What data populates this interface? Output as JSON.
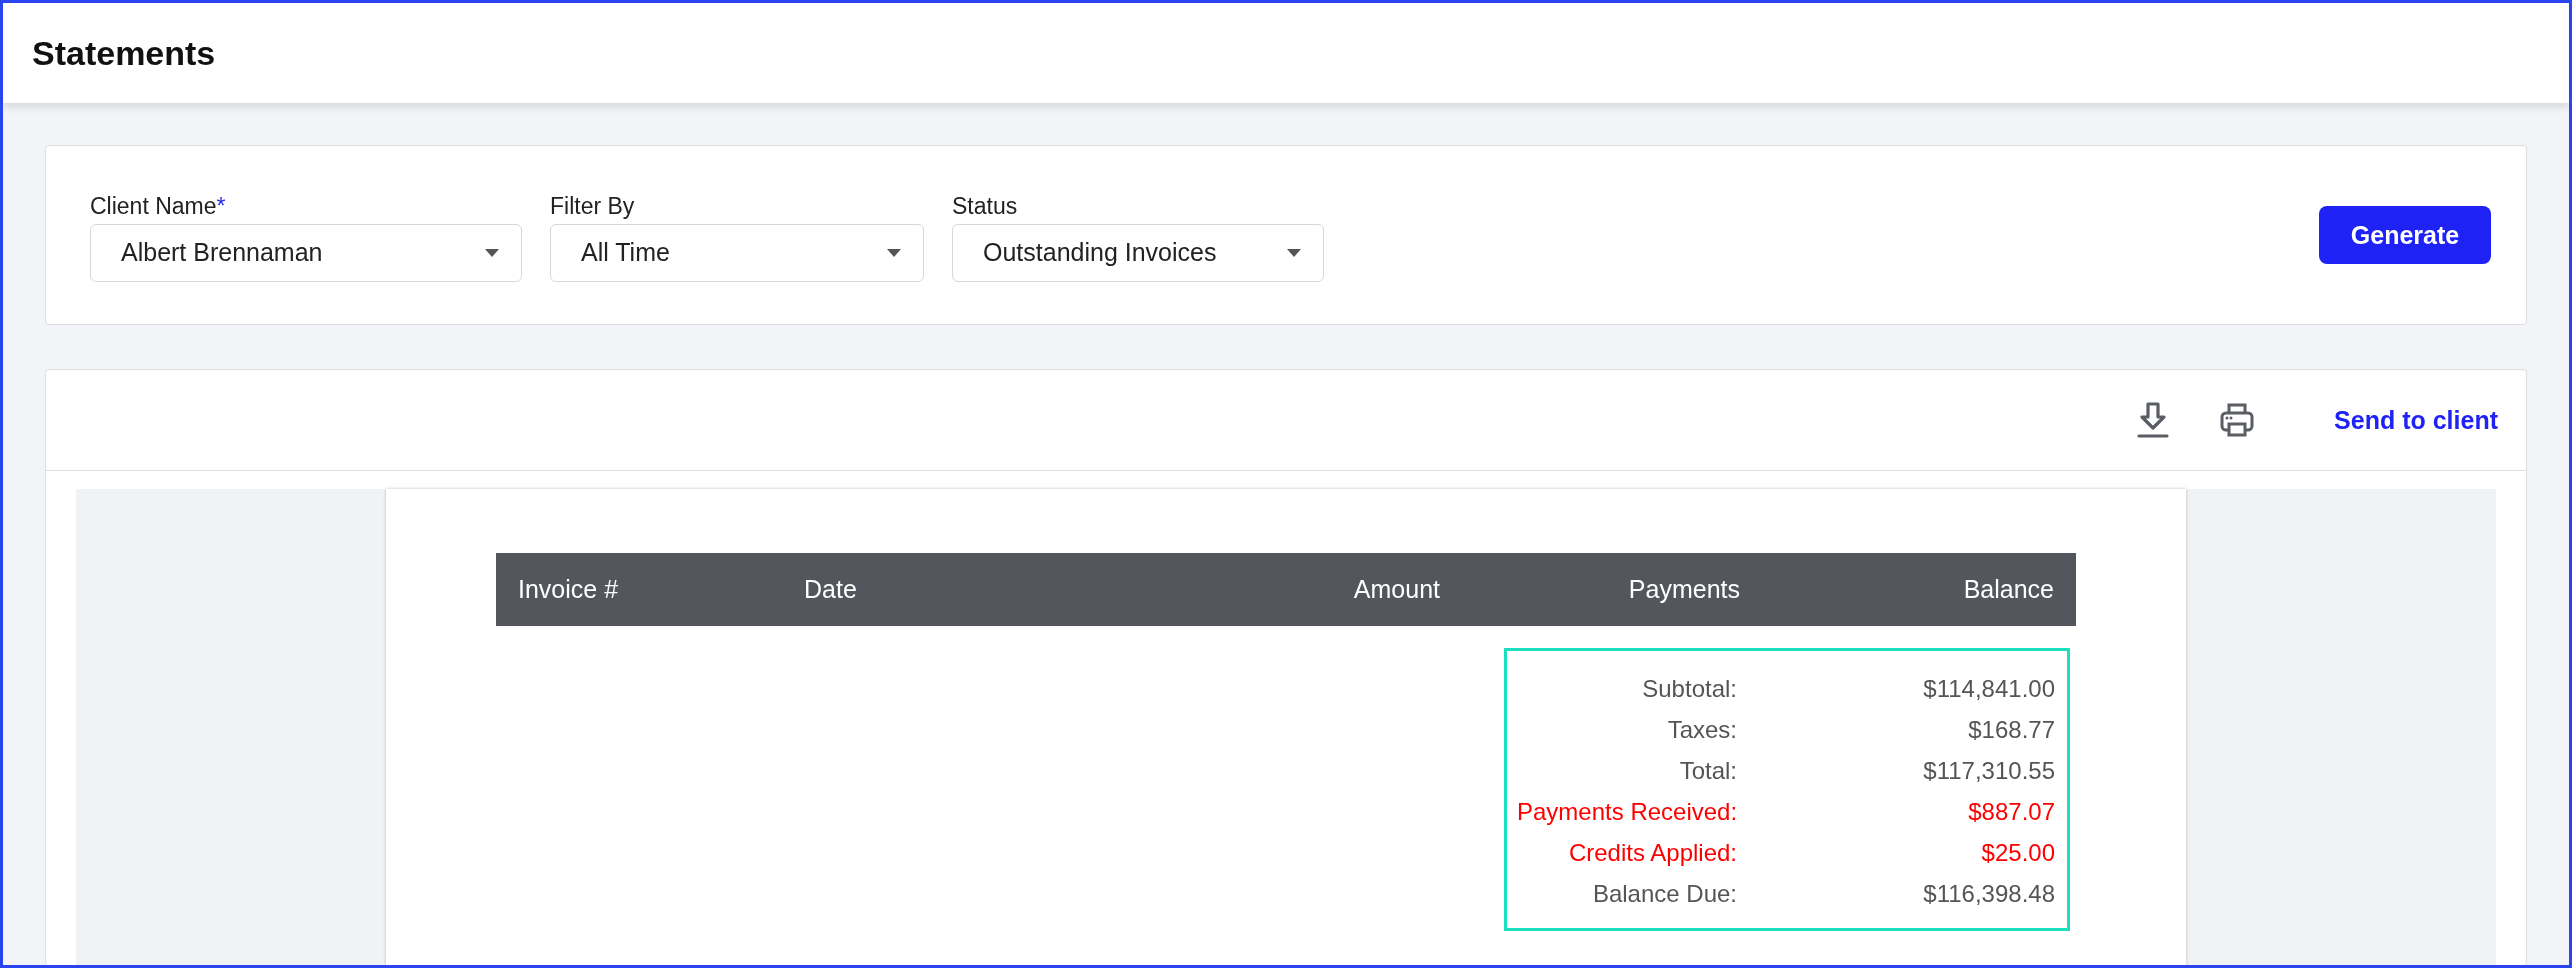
{
  "page_title": "Statements",
  "filters": [
    {
      "label": "Client Name",
      "required_mark": "*",
      "value": "Albert Brennaman"
    },
    {
      "label": "Filter By",
      "value": "All Time"
    },
    {
      "label": "Status",
      "value": "Outstanding Invoices"
    }
  ],
  "generate_button": "Generate",
  "toolbar": {
    "send_link": "Send to client"
  },
  "table": {
    "columns": [
      "Invoice #",
      "Date",
      "Amount",
      "Payments",
      "Balance"
    ]
  },
  "summary": [
    {
      "label": "Subtotal:",
      "value": "$114,841.00",
      "highlight": false
    },
    {
      "label": "Taxes:",
      "value": "$168.77",
      "highlight": false
    },
    {
      "label": "Total:",
      "value": "$117,310.55",
      "highlight": false
    },
    {
      "label": "Payments Received:",
      "value": "$887.07",
      "highlight": true
    },
    {
      "label": "Credits Applied:",
      "value": "$25.00",
      "highlight": true
    },
    {
      "label": "Balance Due:",
      "value": "$116,398.48",
      "highlight": false
    }
  ]
}
